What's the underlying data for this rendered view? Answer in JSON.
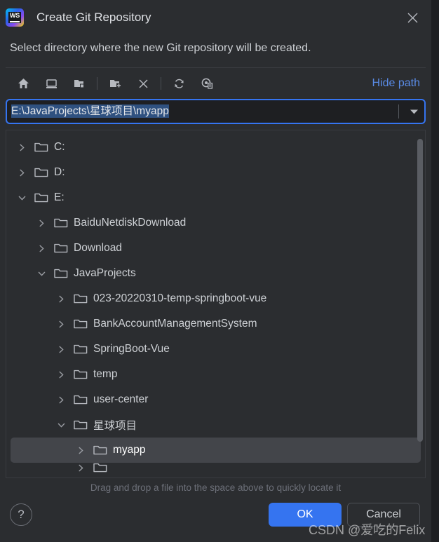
{
  "window": {
    "title": "Create Git Repository",
    "app_icon": "webstorm-icon",
    "close_icon": "close-icon"
  },
  "prompt": "Select directory where the new Git repository will be created.",
  "toolbar": {
    "items": [
      {
        "icon": "home-icon",
        "name": "home-button"
      },
      {
        "icon": "desktop-icon",
        "name": "desktop-button"
      },
      {
        "icon": "project-folder-icon",
        "name": "project-folder-button"
      },
      {
        "icon": "new-folder-icon",
        "name": "new-folder-button"
      },
      {
        "icon": "delete-icon",
        "name": "delete-button"
      },
      {
        "icon": "refresh-icon",
        "name": "refresh-button"
      },
      {
        "icon": "show-hidden-icon",
        "name": "show-hidden-button"
      }
    ],
    "hide_path_label": "Hide path"
  },
  "path_field": {
    "value": "E:\\JavaProjects\\星球项目\\myapp",
    "selected": true,
    "dropdown_icon": "chevron-down-icon"
  },
  "tree": {
    "rows": [
      {
        "label": "C:",
        "depth": 0,
        "state": "collapsed",
        "selected": false
      },
      {
        "label": "D:",
        "depth": 0,
        "state": "collapsed",
        "selected": false
      },
      {
        "label": "E:",
        "depth": 0,
        "state": "expanded",
        "selected": false
      },
      {
        "label": "BaiduNetdiskDownload",
        "depth": 1,
        "state": "collapsed",
        "selected": false
      },
      {
        "label": "Download",
        "depth": 1,
        "state": "collapsed",
        "selected": false
      },
      {
        "label": "JavaProjects",
        "depth": 1,
        "state": "expanded",
        "selected": false
      },
      {
        "label": "023-20220310-temp-springboot-vue",
        "depth": 2,
        "state": "collapsed",
        "selected": false
      },
      {
        "label": "BankAccountManagementSystem",
        "depth": 2,
        "state": "collapsed",
        "selected": false
      },
      {
        "label": "SpringBoot-Vue",
        "depth": 2,
        "state": "collapsed",
        "selected": false
      },
      {
        "label": "temp",
        "depth": 2,
        "state": "collapsed",
        "selected": false
      },
      {
        "label": "user-center",
        "depth": 2,
        "state": "collapsed",
        "selected": false
      },
      {
        "label": "星球项目",
        "depth": 2,
        "state": "expanded",
        "selected": false
      },
      {
        "label": "myapp",
        "depth": 3,
        "state": "collapsed",
        "selected": true
      }
    ],
    "scrollbar": {
      "thumb_top_pct": 2,
      "thumb_height_pct": 88
    }
  },
  "hint": "Drag and drop a file into the space above to quickly locate it",
  "footer": {
    "help_label": "?",
    "ok_label": "OK",
    "cancel_label": "Cancel"
  },
  "watermark": "CSDN @爱吃的Felix",
  "colors": {
    "dialog_bg": "#2b2d30",
    "field_bg": "#1e1f22",
    "accent": "#3574f0",
    "link": "#5a8ce8",
    "text": "#cdd0d4",
    "selection": "#2f5180",
    "row_selected": "#43454a"
  }
}
